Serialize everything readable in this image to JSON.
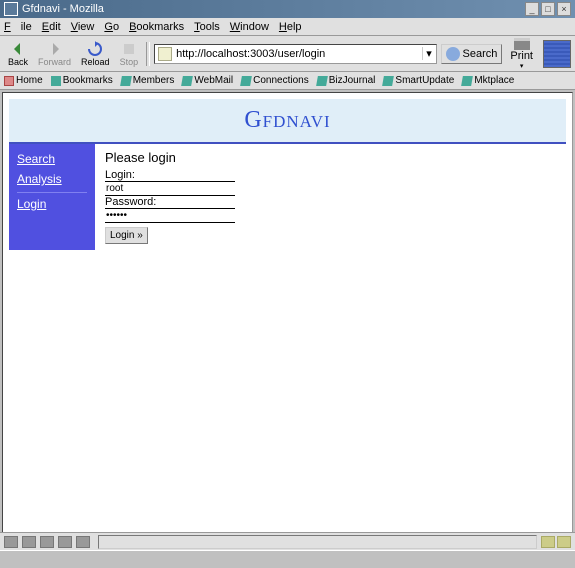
{
  "window": {
    "title": "Gfdnavi - Mozilla"
  },
  "menu": {
    "file": "File",
    "edit": "Edit",
    "view": "View",
    "go": "Go",
    "bookmarks": "Bookmarks",
    "tools": "Tools",
    "window": "Window",
    "help": "Help"
  },
  "toolbar": {
    "back": "Back",
    "forward": "Forward",
    "reload": "Reload",
    "stop": "Stop",
    "search": "Search",
    "print": "Print"
  },
  "url": "http://localhost:3003/user/login",
  "linkbar": {
    "home": "Home",
    "bookmarks": "Bookmarks",
    "members": "Members",
    "webmail": "WebMail",
    "connections": "Connections",
    "bizjournal": "BizJournal",
    "smartupdate": "SmartUpdate",
    "mktplace": "Mktplace"
  },
  "app": {
    "title": "Gfdnavi"
  },
  "sidebar": {
    "search": "Search",
    "analysis": "Analysis",
    "login": "Login"
  },
  "form": {
    "heading": "Please login",
    "login_label": "Login:",
    "login_value": "root",
    "password_label": "Password:",
    "password_value": "••••••",
    "submit": "Login »"
  }
}
